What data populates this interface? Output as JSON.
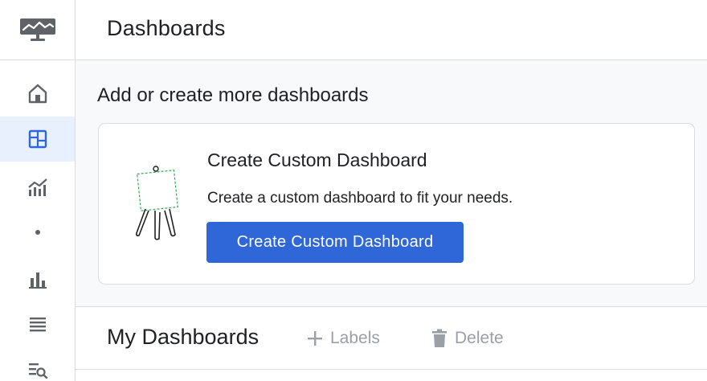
{
  "header": {
    "title": "Dashboards"
  },
  "nav": {
    "items": [
      {
        "icon": "home-icon"
      },
      {
        "icon": "dashboard-icon",
        "active": true
      },
      {
        "icon": "analytics-chart-icon"
      },
      {
        "icon": "dot-icon"
      },
      {
        "icon": "bar-chart-icon"
      },
      {
        "icon": "list-icon"
      },
      {
        "icon": "search-list-icon"
      }
    ]
  },
  "add_section": {
    "heading": "Add or create more dashboards",
    "card": {
      "title": "Create Custom Dashboard",
      "description": "Create a custom dashboard to fit your needs.",
      "button_label": "Create Custom Dashboard"
    }
  },
  "my_dashboards": {
    "title": "My Dashboards",
    "labels_action": "Labels",
    "delete_action": "Delete"
  },
  "colors": {
    "accent": "#2f67d8",
    "active_nav_bg": "#e8f0fe",
    "nav_icon": "#5f6368",
    "disabled_text": "#9aa0a6"
  }
}
